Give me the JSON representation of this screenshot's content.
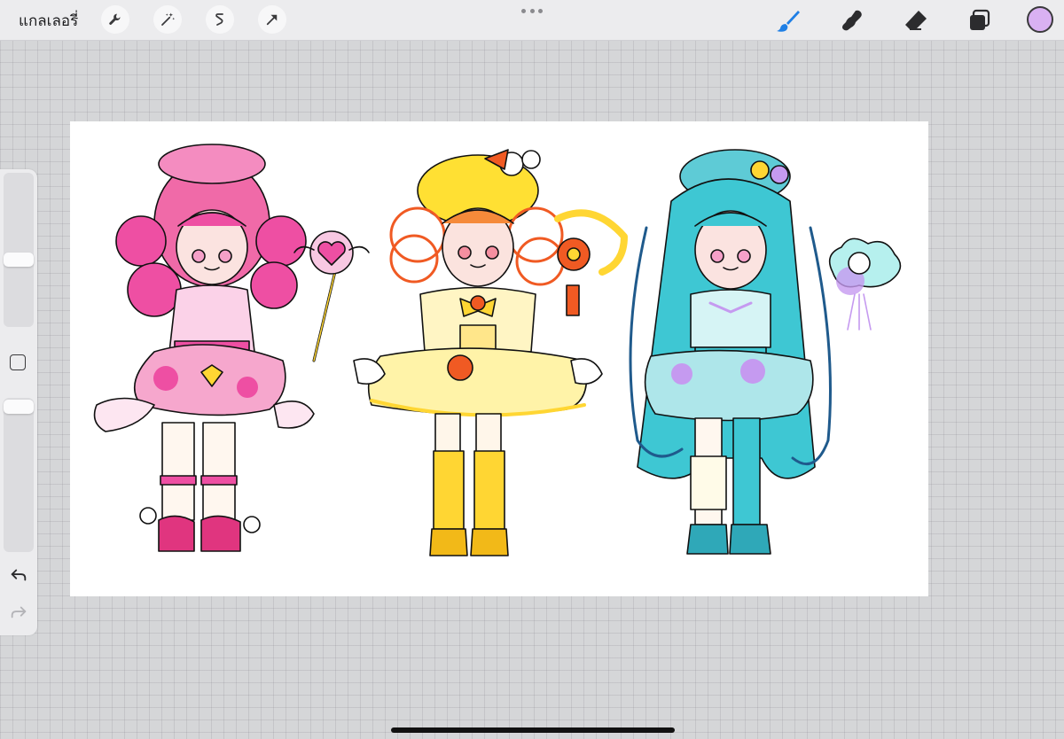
{
  "topbar": {
    "gallery_label": "แกลเลอรี่",
    "left_tools": [
      {
        "icon": "wrench-icon",
        "name": "actions"
      },
      {
        "icon": "magic-wand-icon",
        "name": "adjustments"
      },
      {
        "icon": "selection-icon",
        "name": "selection"
      },
      {
        "icon": "transform-arrow-icon",
        "name": "transform"
      }
    ],
    "right_tools": [
      {
        "icon": "brush-icon",
        "name": "brush",
        "active": true
      },
      {
        "icon": "smudge-icon",
        "name": "smudge"
      },
      {
        "icon": "eraser-icon",
        "name": "eraser"
      },
      {
        "icon": "layers-icon",
        "name": "layers"
      }
    ],
    "current_color": "#d9b1f2",
    "active_color": "#1f7fe5"
  },
  "sidebar": {
    "size_slider": {
      "icon": "brush-size-slider"
    },
    "opacity_slider": {
      "icon": "opacity-slider"
    },
    "modify_button": {
      "icon": "square-icon"
    },
    "undo": {
      "icon": "undo-icon"
    },
    "redo": {
      "icon": "redo-icon"
    }
  },
  "canvas": {
    "background": "#ffffff",
    "artwork_colors": {
      "pink": "#ee4fa3",
      "yellow": "#ffd633",
      "orange": "#f05a23",
      "teal": "#3ec7d3",
      "lavender": "#c59af0"
    }
  }
}
